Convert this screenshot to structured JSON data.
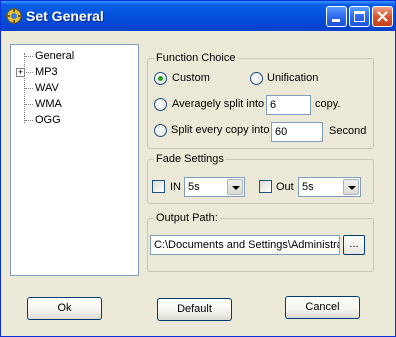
{
  "window": {
    "title": "Set General"
  },
  "titlebar_buttons": {
    "minimize": "minimize-icon",
    "maximize": "maximize-icon",
    "close": "close-icon"
  },
  "tree": {
    "items": [
      {
        "label": "General",
        "expandable": false
      },
      {
        "label": "MP3",
        "expandable": true
      },
      {
        "label": "WAV",
        "expandable": false
      },
      {
        "label": "WMA",
        "expandable": false
      },
      {
        "label": "OGG",
        "expandable": false
      }
    ],
    "expander_glyph": "+"
  },
  "function_choice": {
    "title": "Function Choice",
    "custom_label": "Custom",
    "unification_label": "Unification",
    "split_into_label": "Averagely split into",
    "split_into_value": "6",
    "split_into_unit": "copy.",
    "split_every_label": "Split every copy into",
    "split_every_value": "60",
    "split_every_unit": "Second",
    "selected": "Custom"
  },
  "fade_settings": {
    "title": "Fade Settings",
    "in_label": "IN",
    "in_value": "5s",
    "in_checked": false,
    "out_label": "Out",
    "out_value": "5s",
    "out_checked": false
  },
  "output_path": {
    "title": "Output Path:",
    "value": "C:\\Documents and Settings\\Administra",
    "browse_label": "..."
  },
  "buttons": {
    "ok": "Ok",
    "default": "Default",
    "cancel": "Cancel"
  },
  "colors": {
    "titlebar": "#0453dd",
    "background": "#ece9d8",
    "close_button": "#d9542b",
    "radio_dot": "#21a121"
  }
}
